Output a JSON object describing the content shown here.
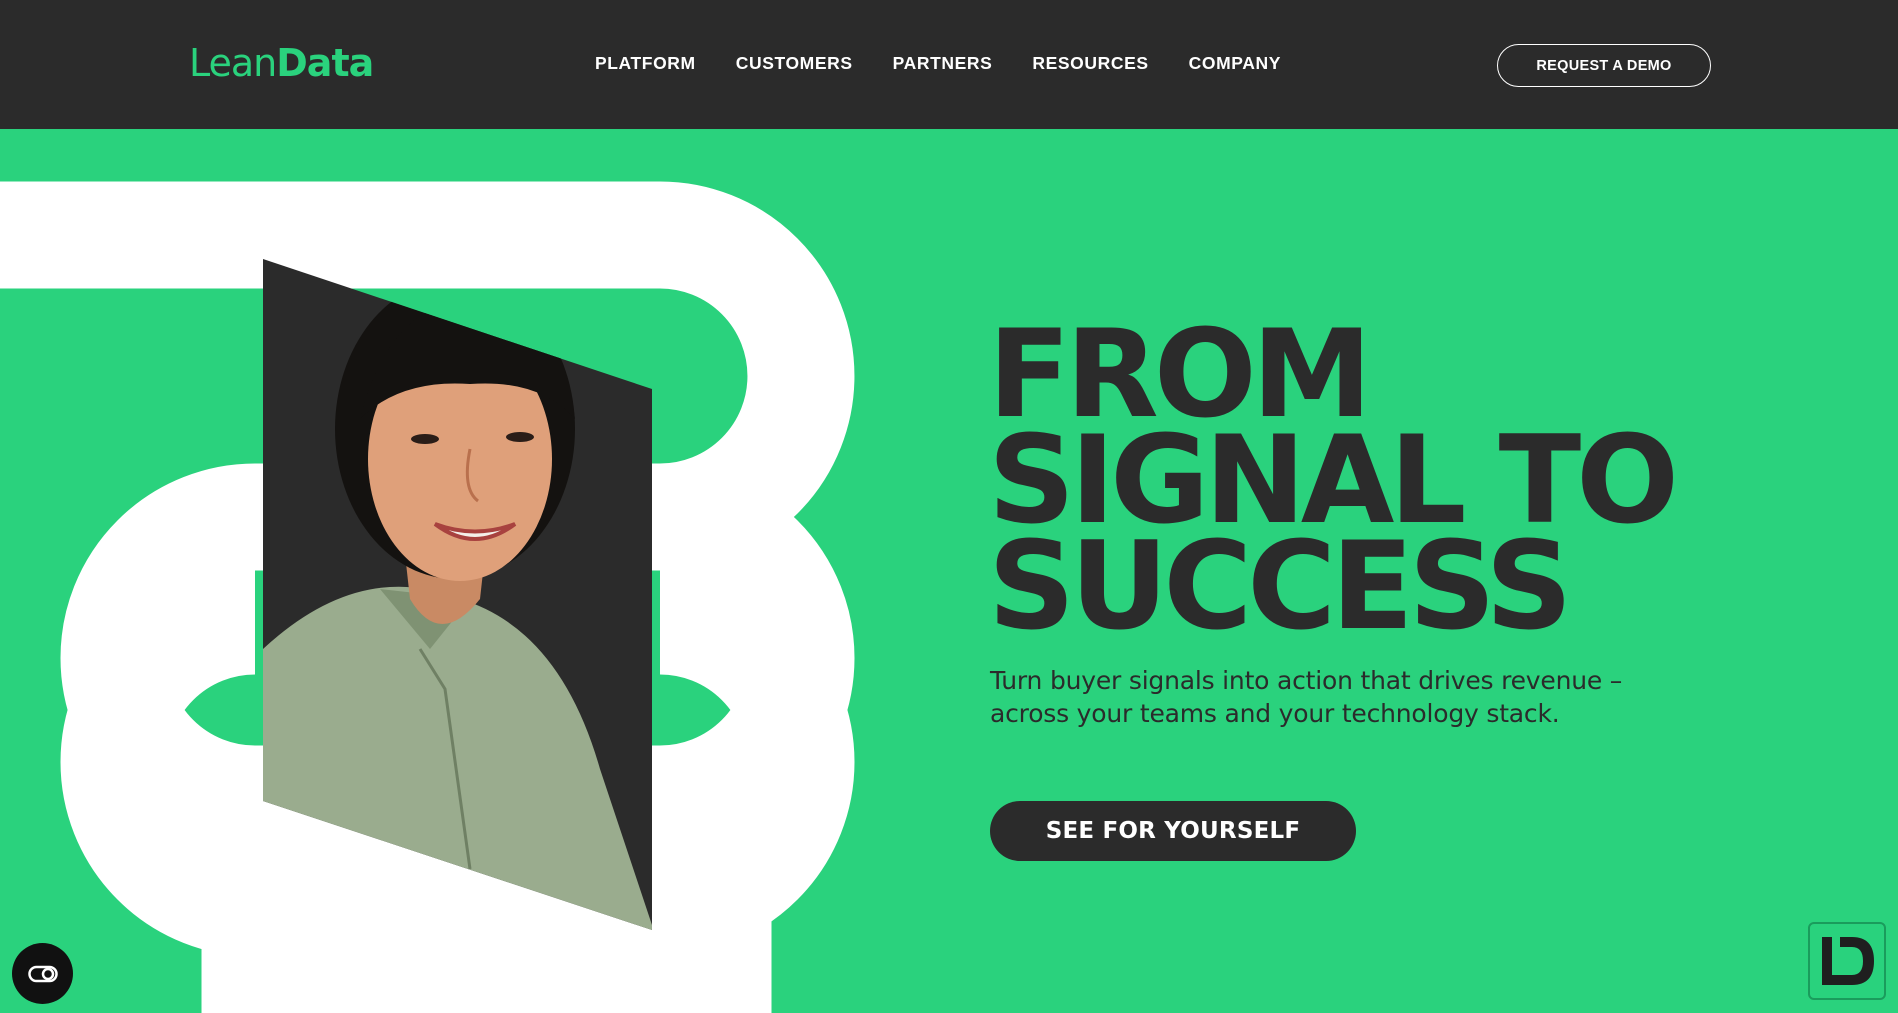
{
  "header": {
    "logo": {
      "part1": "Lean",
      "part2": "Data"
    },
    "nav": [
      "PLATFORM",
      "CUSTOMERS",
      "PARTNERS",
      "RESOURCES",
      "COMPANY"
    ],
    "demo_button": "REQUEST A DEMO"
  },
  "hero": {
    "headline": [
      "FROM",
      "SIGNAL TO",
      "SUCCESS"
    ],
    "subtext": "Turn buyer signals into action that drives revenue – across your teams and your technology stack.",
    "cta": "SEE FOR YOURSELF"
  },
  "colors": {
    "brand_green": "#2ad27d",
    "dark": "#2b2b2b",
    "white": "#ffffff"
  },
  "icons": {
    "accessibility": "accessibility-toggle-icon",
    "badge": "leandata-ld-badge-icon"
  }
}
